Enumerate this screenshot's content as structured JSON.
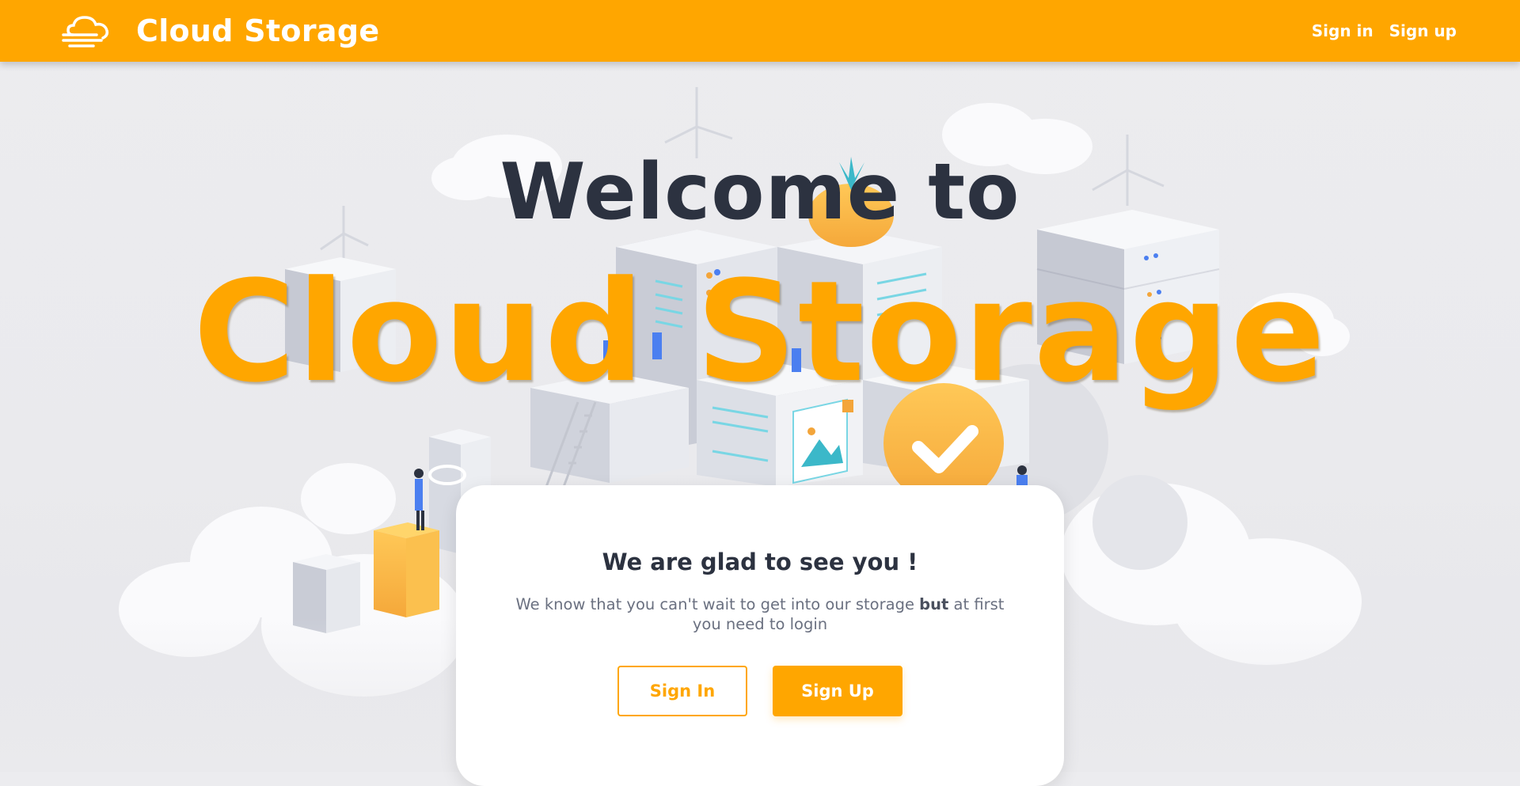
{
  "navbar": {
    "logo_icon": "cloud-icon",
    "brand": "Cloud Storage",
    "links": [
      {
        "label": "Sign in"
      },
      {
        "label": "Sign up"
      }
    ],
    "color": "#ffa600"
  },
  "hero": {
    "title_line1": "Welcome to",
    "title_line2": "Cloud Storage"
  },
  "card": {
    "heading": "We are glad to see you !",
    "text_part1": "We know that you can't wait to get into our storage ",
    "text_bold": "but",
    "text_part2": " at first you need to login",
    "signin_label": "Sign In",
    "signup_label": "Sign Up"
  },
  "colors": {
    "accent": "#ffa600",
    "heading": "#2c3240",
    "muted": "#6a7080"
  }
}
